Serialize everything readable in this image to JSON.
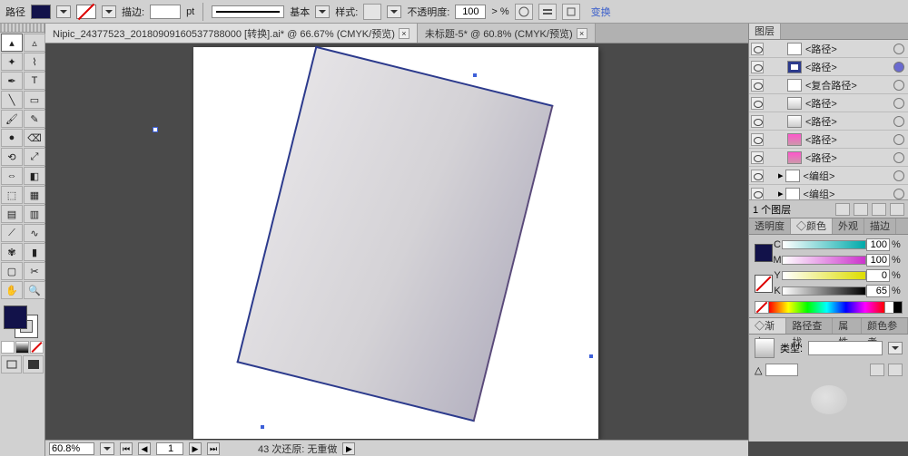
{
  "controlbar": {
    "object_label": "路径",
    "fill_color": "#12124a",
    "stroke_none": true,
    "stroke_label": "描边:",
    "stroke_pt_suffix": "pt",
    "brush_label": "基本",
    "style_label": "样式:",
    "opacity_label": "不透明度:",
    "opacity_value": "100",
    "opacity_suffix": "> %",
    "transform_link": "变换"
  },
  "tabs": [
    {
      "title": "Nipic_24377523_20180909160537788000  [转换].ai* @ 66.67% (CMYK/预览)",
      "active": true
    },
    {
      "title": "未标题-5* @ 60.8% (CMYK/预览)",
      "active": false
    }
  ],
  "layers_panel": {
    "tab": "图层",
    "items": [
      {
        "label": "<路径>",
        "thumb": "plain",
        "target": "empty"
      },
      {
        "label": "<路径>",
        "thumb": "navy",
        "target": "fill"
      },
      {
        "label": "<复合路径>",
        "thumb": "plain",
        "target": "empty"
      },
      {
        "label": "<路径>",
        "thumb": "grad",
        "target": "empty"
      },
      {
        "label": "<路径>",
        "thumb": "grad",
        "target": "empty"
      },
      {
        "label": "<路径>",
        "thumb": "pink",
        "target": "empty"
      },
      {
        "label": "<路径>",
        "thumb": "pink",
        "target": "empty"
      },
      {
        "label": "<编组>",
        "thumb": "grp",
        "target": "empty",
        "expand": true
      },
      {
        "label": "<编组>",
        "thumb": "grp",
        "target": "empty",
        "expand": true
      }
    ],
    "footer": "1 个图层"
  },
  "color_panel": {
    "tabs": [
      "透明度",
      "◇颜色",
      "外观",
      "描边"
    ],
    "active_tab": 1,
    "channels": [
      {
        "k": "C",
        "v": "100"
      },
      {
        "k": "M",
        "v": "100"
      },
      {
        "k": "Y",
        "v": "0"
      },
      {
        "k": "K",
        "v": "65"
      }
    ],
    "pct": "%"
  },
  "grad_panel": {
    "tabs": [
      "◇渐变",
      "路径查找",
      "属性",
      "颜色参考"
    ],
    "type_label": "类型:",
    "angle_label": "△"
  },
  "statusbar": {
    "zoom": "60.8%",
    "artboard": "1",
    "undo_text": "43 次还原: 无重做"
  },
  "tools": [
    "selection",
    "direct-selection",
    "magic-wand",
    "lasso",
    "pen",
    "type",
    "line",
    "rectangle",
    "paintbrush",
    "pencil",
    "blob-brush",
    "eraser",
    "rotate",
    "scale",
    "width",
    "free-transform",
    "shape-builder",
    "perspective",
    "mesh",
    "gradient",
    "eyedropper",
    "blend",
    "symbol-sprayer",
    "column-graph",
    "artboard",
    "slice",
    "hand",
    "zoom"
  ],
  "icons": {
    "close": "×",
    "expand": "▸"
  }
}
